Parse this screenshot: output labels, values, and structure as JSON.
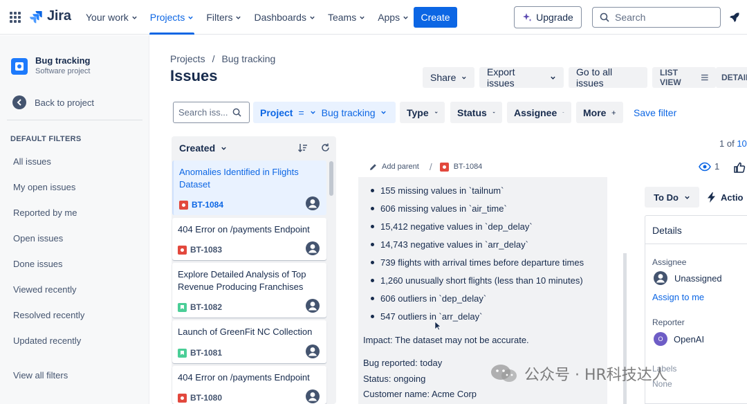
{
  "topnav": {
    "logo": "Jira",
    "items": [
      {
        "label": "Your work"
      },
      {
        "label": "Projects"
      },
      {
        "label": "Filters"
      },
      {
        "label": "Dashboards"
      },
      {
        "label": "Teams"
      },
      {
        "label": "Apps"
      }
    ],
    "active_item": "Projects",
    "create_label": "Create",
    "upgrade_label": "Upgrade",
    "search_placeholder": "Search",
    "accent": "#0c66e4"
  },
  "sidebar": {
    "project_name": "Bug tracking",
    "project_type": "Software project",
    "back_label": "Back to project",
    "filters_heading": "DEFAULT FILTERS",
    "filters": [
      {
        "label": "All issues"
      },
      {
        "label": "My open issues"
      },
      {
        "label": "Reported by me"
      },
      {
        "label": "Open issues"
      },
      {
        "label": "Done issues"
      },
      {
        "label": "Viewed recently"
      },
      {
        "label": "Resolved recently"
      },
      {
        "label": "Updated recently"
      }
    ],
    "view_all": "View all filters"
  },
  "header": {
    "breadcrumb": [
      "Projects",
      "/",
      "Bug tracking"
    ],
    "title": "Issues",
    "share": "Share",
    "export": "Export issues",
    "go_all": "Go to all issues",
    "list_view": "LIST VIEW",
    "detail_view": "DETAIL"
  },
  "filterbar": {
    "search_placeholder": "Search iss...",
    "project_label": "Project",
    "project_op": "=",
    "project_value": "Bug tracking",
    "type": "Type",
    "status": "Status",
    "assignee": "Assignee",
    "more": "More",
    "save_filter": "Save filter",
    "pagination_prefix": "1 of",
    "pagination_total": "10"
  },
  "issue_list": {
    "sort_label": "Created",
    "issues": [
      {
        "title": "Anomalies Identified in Flights Dataset",
        "key": "BT-1084",
        "type": "bug",
        "selected": true
      },
      {
        "title": "404 Error on /payments Endpoint",
        "key": "BT-1083",
        "type": "bug"
      },
      {
        "title": "Explore Detailed Analysis of Top Revenue Producing Franchises",
        "key": "BT-1082",
        "type": "story"
      },
      {
        "title": "Launch of GreenFit NC Collection",
        "key": "BT-1081",
        "type": "story"
      },
      {
        "title": "404 Error on /payments Endpoint",
        "key": "BT-1080",
        "type": "bug"
      }
    ]
  },
  "detail": {
    "add_parent": "Add parent",
    "issue_key": "BT-1084",
    "bullets": [
      "155 missing values in `tailnum`",
      "606 missing values in `air_time`",
      "15,412 negative values in `dep_delay`",
      "14,743 negative values in `arr_delay`",
      "739 flights with arrival times before departure times",
      "1,260 unusually short flights (less than 10 minutes)",
      "606 outliers in `dep_delay`",
      "547 outliers in `arr_delay`"
    ],
    "impact": "Impact: The dataset may not be accurate.",
    "reported": "Bug reported: today",
    "status_line": "Status: ongoing",
    "customer": "Customer name: Acme Corp"
  },
  "sidepanel": {
    "watchers": "1",
    "status": "To Do",
    "actions": "Actio",
    "details_heading": "Details",
    "assignee_label": "Assignee",
    "assignee_value": "Unassigned",
    "assign_me": "Assign to me",
    "reporter_label": "Reporter",
    "reporter_value": "OpenAI",
    "reporter_initial": "O",
    "labels_label": "Labels",
    "labels_value": "None"
  },
  "watermark": {
    "text": "公众号 · HR科技达人"
  }
}
